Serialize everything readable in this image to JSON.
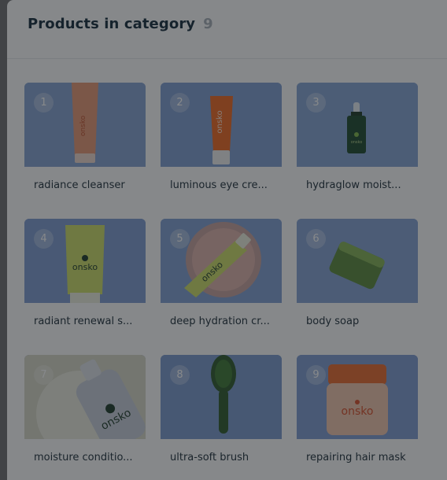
{
  "header": {
    "title": "Products in category",
    "count": "9"
  },
  "products": [
    {
      "number": "1",
      "name": "radiance cleanser",
      "image_icon": "orange-tube-icon",
      "bg": "#86a3d4"
    },
    {
      "number": "2",
      "name": "luminous eye cre...",
      "image_icon": "orange-tube-icon",
      "bg": "#7f9fd4"
    },
    {
      "number": "3",
      "name": "hydraglow moist...",
      "image_icon": "dropper-bottle-icon",
      "bg": "#86a5d6"
    },
    {
      "number": "4",
      "name": "radiant renewal s...",
      "image_icon": "green-tube-icon",
      "bg": "#7f9dd3"
    },
    {
      "number": "5",
      "name": "deep hydration cr...",
      "image_icon": "tube-on-plate-icon",
      "bg": "#83a2d5"
    },
    {
      "number": "6",
      "name": "body soap",
      "image_icon": "soap-bar-icon",
      "bg": "#86a4d6"
    },
    {
      "number": "7",
      "name": "moisture conditio...",
      "image_icon": "pump-bottle-icon",
      "bg": "#d9d9c9"
    },
    {
      "number": "8",
      "name": "ultra-soft brush",
      "image_icon": "hair-brush-icon",
      "bg": "#7c9cd0"
    },
    {
      "number": "9",
      "name": "repairing hair mask",
      "image_icon": "jar-icon",
      "bg": "#7f9ed4"
    }
  ]
}
